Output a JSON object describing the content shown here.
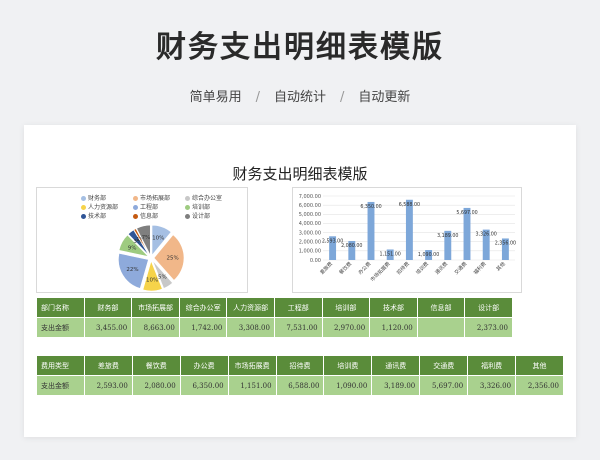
{
  "hero": {
    "title": "财务支出明细表模版",
    "tags": [
      "简单易用",
      "自动统计",
      "自动更新"
    ]
  },
  "sheet": {
    "title": "财务支出明细表模版"
  },
  "colors": {
    "header_green": "#5a8c3a",
    "cell_green": "#a9d18e",
    "bar_blue": "#7da7d9"
  },
  "chart_data": [
    {
      "type": "pie",
      "categories": [
        "财务部",
        "市场拓展部",
        "综合办公室",
        "人力资源部",
        "工程部",
        "培训部",
        "技术部",
        "信息部",
        "设计部"
      ],
      "values": [
        3455.0,
        8663.0,
        1742.0,
        3308.0,
        7531.0,
        2970.0,
        1120.0,
        373.0,
        2373.0
      ],
      "colors": [
        "#a5bfe3",
        "#f1b789",
        "#c8c8c8",
        "#f6d34a",
        "#8eaadb",
        "#9ecb80",
        "#2f5597",
        "#c55a11",
        "#7f7f7f"
      ],
      "slice_labels": [
        "10%",
        "25%",
        "5%",
        "10%",
        "22%",
        "9%",
        "3%",
        "1%",
        "7%"
      ],
      "legend_position": "top"
    },
    {
      "type": "bar",
      "categories": [
        "差旅费",
        "餐饮费",
        "办公费",
        "市场拓展费",
        "招待费",
        "培训费",
        "通讯费",
        "交通费",
        "福利费",
        "其他"
      ],
      "values": [
        2593.0,
        2080.0,
        6350.0,
        1151.0,
        6588.0,
        1090.0,
        3189.0,
        5697.0,
        3326.0,
        2356.0
      ],
      "value_labels": [
        "2,593.00",
        "2,080.00",
        "6,350.00",
        "1,151.00",
        "6,588.00",
        "1,090.00",
        "3,189.00",
        "5,697.00",
        "3,326.00",
        "2,356.00"
      ],
      "yticks": [
        "0.00",
        "1,000.00",
        "2,000.00",
        "3,000.00",
        "4,000.00",
        "5,000.00",
        "6,000.00",
        "7,000.00"
      ],
      "ylim": [
        0,
        7000
      ],
      "grid": true
    }
  ],
  "table_dept": {
    "headers": [
      "部门名称",
      "财务部",
      "市场拓展部",
      "综合办公室",
      "人力资源部",
      "工程部",
      "培训部",
      "技术部",
      "信息部",
      "设计部"
    ],
    "values": [
      "支出金额",
      "3,455.00",
      "8,663.00",
      "1,742.00",
      "3,308.00",
      "7,531.00",
      "2,970.00",
      "1,120.00",
      "",
      "2,373.00"
    ]
  },
  "table_cost": {
    "headers": [
      "费用类型",
      "差旅费",
      "餐饮费",
      "办公费",
      "市场拓展费",
      "招待费",
      "培训费",
      "通讯费",
      "交通费",
      "福利费",
      "其他"
    ],
    "values": [
      "支出金额",
      "2,593.00",
      "2,080.00",
      "6,350.00",
      "1,151.00",
      "6,588.00",
      "1,090.00",
      "3,189.00",
      "5,697.00",
      "3,326.00",
      "2,356.00"
    ]
  }
}
